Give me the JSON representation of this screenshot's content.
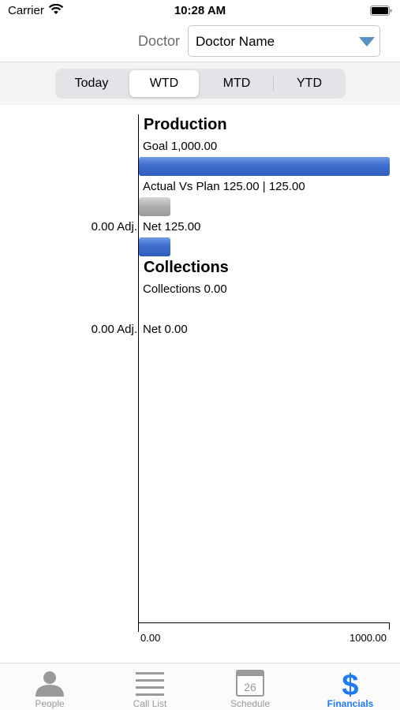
{
  "status_bar": {
    "carrier": "Carrier",
    "time": "10:28 AM"
  },
  "doctor": {
    "label": "Doctor",
    "selected": "Doctor Name"
  },
  "segments": [
    {
      "label": "Today"
    },
    {
      "label": "WTD"
    },
    {
      "label": "MTD"
    },
    {
      "label": "YTD"
    }
  ],
  "active_segment": "WTD",
  "colors": {
    "accent": "#1f7af5",
    "bar_blue": "#3d6fcf",
    "bar_gray": "#acacac",
    "tab_inactive": "#9a9a9a"
  },
  "chart_data": {
    "type": "bar",
    "orientation": "horizontal",
    "xlim": [
      0,
      1000
    ],
    "x_ticks": [
      "0.00",
      "1000.00"
    ],
    "sections": [
      {
        "title": "Production",
        "bars": [
          {
            "label": "Goal 1,000.00",
            "value": 1000,
            "color": "blue"
          },
          {
            "label": "Actual Vs Plan 125.00 | 125.00",
            "value": 125,
            "color": "gray"
          },
          {
            "label": "Net 125.00",
            "value": 125,
            "color": "blue",
            "adj": "0.00 Adj."
          }
        ]
      },
      {
        "title": "Collections",
        "bars": [
          {
            "label": "Collections 0.00",
            "value": 0,
            "color": "blue"
          },
          {
            "label": "Net 0.00",
            "value": 0,
            "color": "blue",
            "adj": "0.00 Adj."
          }
        ]
      }
    ]
  },
  "tabs": [
    {
      "label": "People",
      "icon": "person-icon"
    },
    {
      "label": "Call List",
      "icon": "list-icon"
    },
    {
      "label": "Schedule",
      "icon": "calendar-icon",
      "calendar_day": "26"
    },
    {
      "label": "Financials",
      "icon": "dollar-icon"
    }
  ],
  "active_tab": "Financials"
}
